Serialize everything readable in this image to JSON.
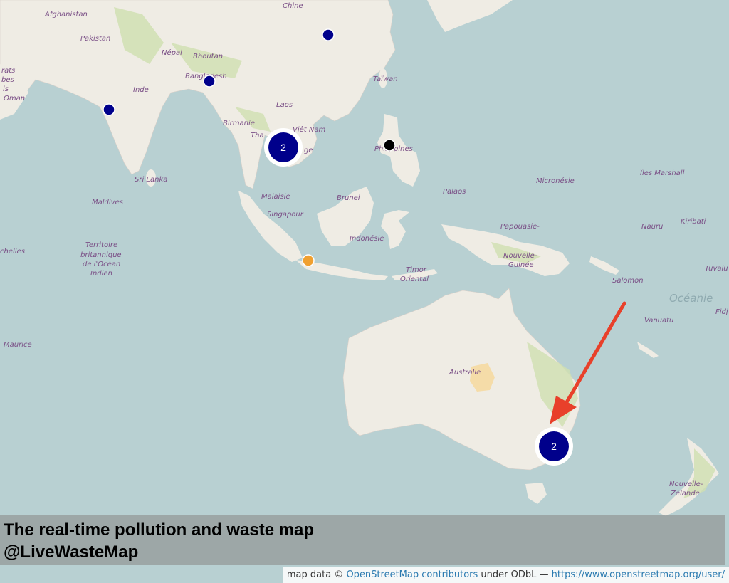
{
  "map": {
    "labels": {
      "afghanistan": "Afghanistan",
      "chine": "Chine",
      "pakistan": "Pakistan",
      "nepal": "Népal",
      "bhoutan": "Bhoutan",
      "bangladesh": "Bangladesh",
      "inde": "Inde",
      "oman": "Oman",
      "emirats": "rats",
      "emirats2": "bes",
      "emirats3": "is",
      "taiwan": "Taïwan",
      "laos": "Laos",
      "birmanie": "Birmanie",
      "viet_nam": "Viêt Nam",
      "thailande": "Tha",
      "cambodge": "ge",
      "philippines": "Philippines",
      "sri_lanka": "Sri Lanka",
      "maldives": "Maldives",
      "malaisie": "Malaisie",
      "brunei": "Brunei",
      "singapour": "Singapour",
      "palaos": "Palaos",
      "micronesie": "Micronésie",
      "iles_marshall": "Îles Marshall",
      "indonesie": "Indonésie",
      "papouasie1": "Papouasie-",
      "papouasie2": "Nouvelle-",
      "papouasie3": "Guinée",
      "nauru": "Nauru",
      "kiribati": "Kiribati",
      "seychelles": "chelles",
      "territoire1": "Territoire",
      "territoire2": "britannique",
      "territoire3": "de l'Océan",
      "territoire4": "Indien",
      "timor1": "Timor",
      "timor2": "Oriental",
      "salomon": "Salomon",
      "tuvalu": "Tuvalu",
      "oceanie": "Océanie",
      "vanuatu": "Vanuatu",
      "fidji": "Fidj",
      "maurice": "Maurice",
      "australie": "Australie",
      "nz1": "Nouvelle-",
      "nz2": "Zélande"
    },
    "markers": [
      {
        "name": "china-marker",
        "color": "#00008b"
      },
      {
        "name": "bangladesh-marker",
        "color": "#00008b"
      },
      {
        "name": "india-marker",
        "color": "#00008b"
      },
      {
        "name": "philippines-marker",
        "color": "#000000"
      },
      {
        "name": "java-marker",
        "color": "#f0a030"
      }
    ],
    "clusters": [
      {
        "name": "cluster-thailand",
        "count": "2"
      },
      {
        "name": "cluster-sydney",
        "count": "2"
      }
    ],
    "arrow_color": "#e8402a",
    "water_color": "#b8d0d2",
    "land_color": "#efece4"
  },
  "caption": {
    "line1": "The real-time pollution and waste map",
    "line2": "@LiveWasteMap"
  },
  "attribution": {
    "prefix": "map data © ",
    "link1": "OpenStreetMap contributors",
    "middle": " under ODbL — ",
    "link2": "https://www.openstreetmap.org/user/"
  }
}
